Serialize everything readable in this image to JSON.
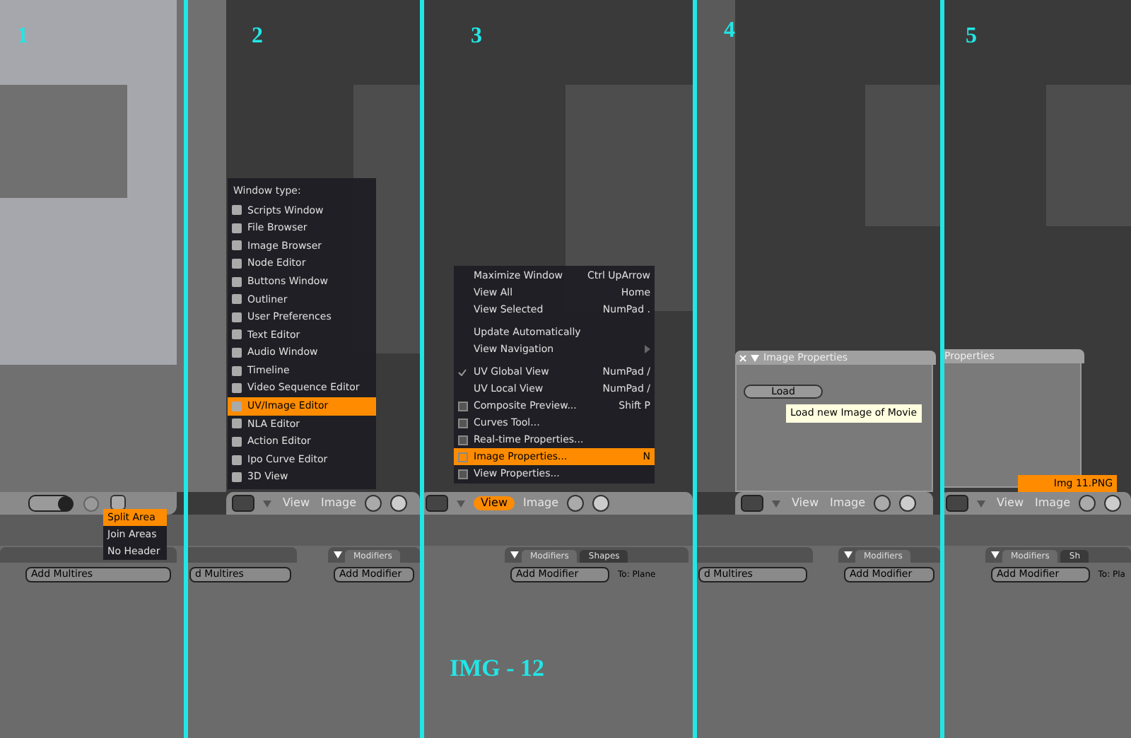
{
  "step_numbers": [
    "1",
    "2",
    "3",
    "4",
    "5"
  ],
  "window_type_menu": {
    "title": "Window type:",
    "items": [
      {
        "label": "Scripts Window",
        "selected": false
      },
      {
        "label": "File Browser",
        "selected": false
      },
      {
        "label": "Image Browser",
        "selected": false
      },
      {
        "label": "Node Editor",
        "selected": false
      },
      {
        "label": "Buttons Window",
        "selected": false
      },
      {
        "label": "Outliner",
        "selected": false
      },
      {
        "label": "User Preferences",
        "selected": false
      },
      {
        "label": "Text Editor",
        "selected": false
      },
      {
        "label": "Audio Window",
        "selected": false
      },
      {
        "label": "Timeline",
        "selected": false
      },
      {
        "label": "Video Sequence Editor",
        "selected": false
      },
      {
        "label": "UV/Image Editor",
        "selected": true
      },
      {
        "label": "NLA Editor",
        "selected": false
      },
      {
        "label": "Action Editor",
        "selected": false
      },
      {
        "label": "Ipo Curve Editor",
        "selected": false
      },
      {
        "label": "3D View",
        "selected": false
      }
    ]
  },
  "view_menu": {
    "items": [
      {
        "kind": "item",
        "label": "Maximize Window",
        "shortcut": "Ctrl UpArrow",
        "selected": false
      },
      {
        "kind": "item",
        "label": "View All",
        "shortcut": "Home",
        "selected": false
      },
      {
        "kind": "item",
        "label": "View Selected",
        "shortcut": "NumPad .",
        "selected": false
      },
      {
        "kind": "separator"
      },
      {
        "kind": "item",
        "label": "Update Automatically",
        "selected": false
      },
      {
        "kind": "submenu",
        "label": "View Navigation",
        "selected": false
      },
      {
        "kind": "separator"
      },
      {
        "kind": "check",
        "label": "UV Global View",
        "shortcut": "NumPad /",
        "checked": true,
        "selected": false
      },
      {
        "kind": "check",
        "label": "UV Local View",
        "shortcut": "NumPad /",
        "checked": false,
        "selected": false
      },
      {
        "kind": "panel",
        "label": "Composite Preview...",
        "shortcut": "Shift P",
        "selected": false
      },
      {
        "kind": "panel",
        "label": "Curves Tool...",
        "selected": false
      },
      {
        "kind": "panel",
        "label": "Real-time Properties...",
        "selected": false
      },
      {
        "kind": "panel",
        "label": "Image Properties...",
        "shortcut": "N",
        "selected": true
      },
      {
        "kind": "panel",
        "label": "View Properties...",
        "selected": false
      }
    ]
  },
  "headers": [
    {
      "view": "View",
      "image": "Image",
      "view_selected": false
    },
    {
      "view": "View",
      "image": "Image",
      "view_selected": true
    },
    {
      "view": "View",
      "image": "Image",
      "view_selected": false
    },
    {
      "view": "View",
      "image": "Image",
      "view_selected": false
    }
  ],
  "area_menu": [
    {
      "label": "Split Area",
      "selected": true
    },
    {
      "label": "Join Areas",
      "selected": false
    },
    {
      "label": "No Header",
      "selected": false
    }
  ],
  "image_properties_panels": [
    {
      "title": "Image Properties",
      "load": "Load",
      "tooltip": "Load new Image of Movie"
    },
    {
      "title": "Properties"
    }
  ],
  "image_dropdown": "Img 11.PNG",
  "bottom_panels": [
    {
      "buttons": [
        "Add Multires"
      ]
    },
    {
      "buttons": [
        "d Multires"
      ]
    },
    {
      "tabs": [
        "Modifiers"
      ],
      "buttons": [
        "Add Modifier"
      ]
    },
    {
      "tabs": [
        "Modifiers",
        "Shapes"
      ],
      "buttons": [
        "Add Modifier"
      ],
      "target": "To: Plane"
    },
    {
      "buttons": [
        "d Multires"
      ]
    },
    {
      "tabs": [
        "Modifiers"
      ],
      "buttons": [
        "Add Modifier"
      ]
    },
    {
      "tabs": [
        "Modifiers",
        "Sh"
      ],
      "buttons": [
        "Add Modifier"
      ],
      "target": "To: Pla"
    }
  ],
  "caption": "IMG - 12"
}
